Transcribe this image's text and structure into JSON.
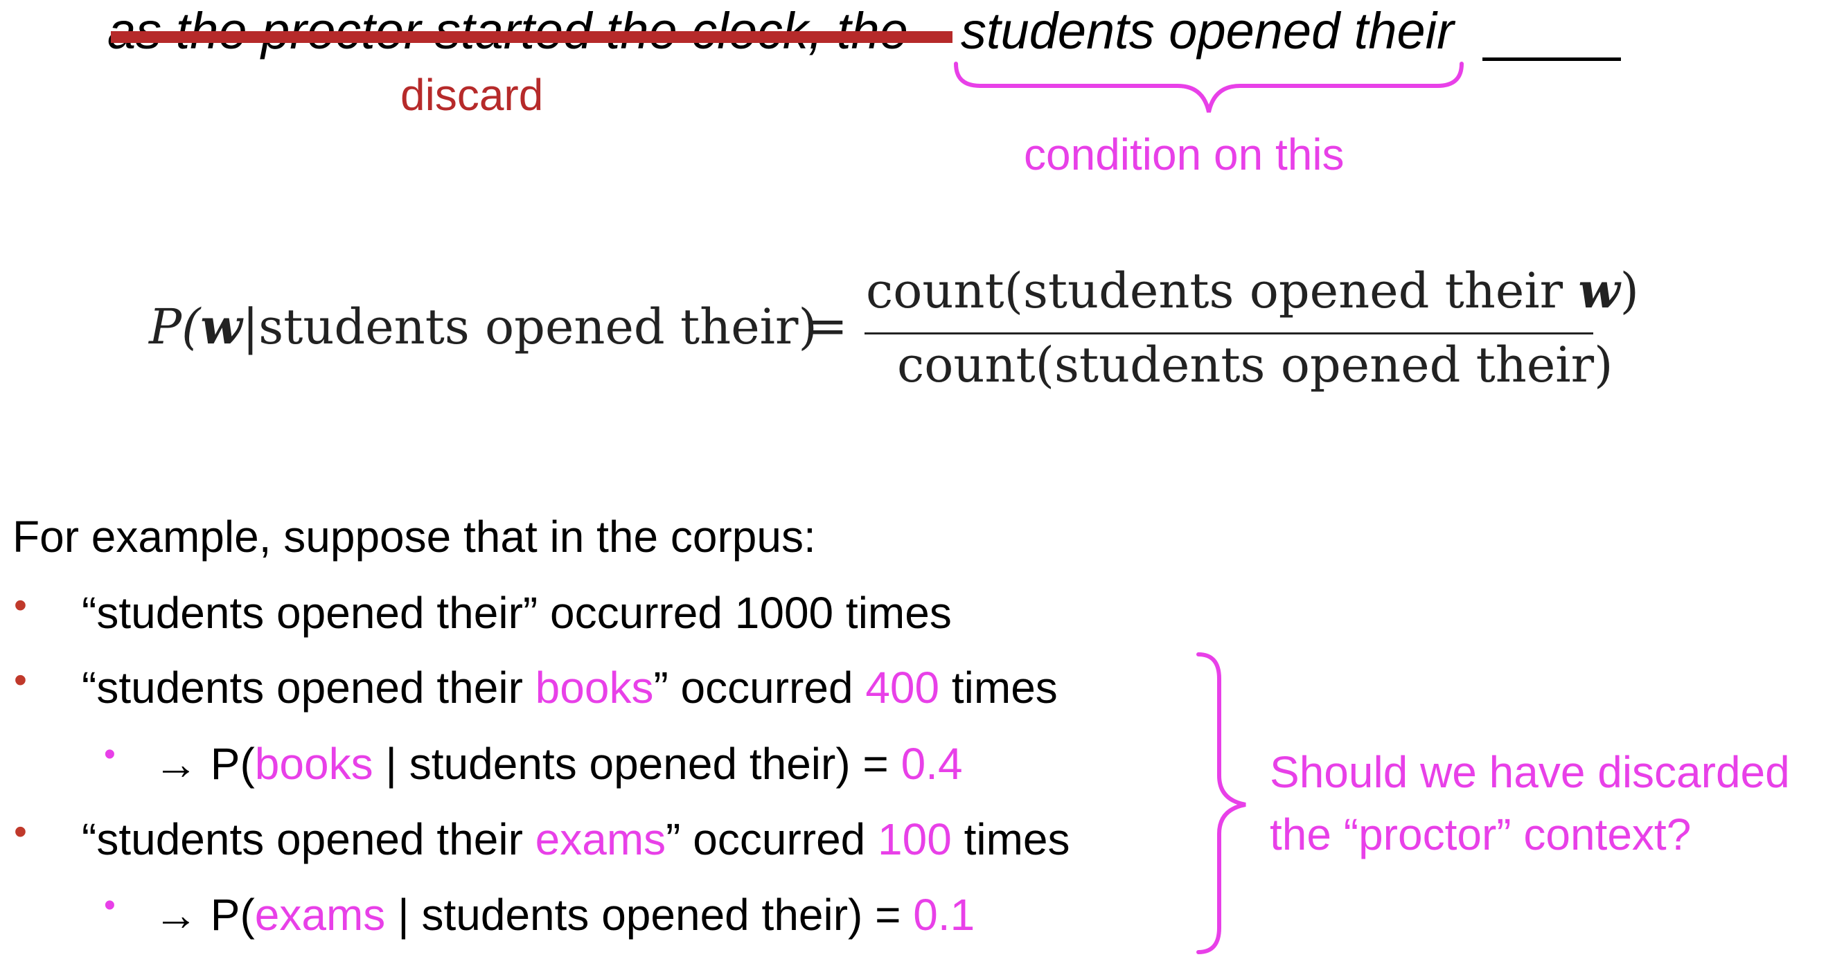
{
  "sentence": {
    "discarded_text": "as the proctor started the clock, the",
    "kept_text": "students opened their",
    "discard_label": "discard",
    "condition_label": "condition on this"
  },
  "formula": {
    "lhs_p": "P(",
    "lhs_w": "w",
    "lhs_rest": "|students opened their)",
    "eq": "=",
    "num_pre": "count(students opened their ",
    "num_w": "w",
    "num_post": ")",
    "den": "count(students opened their)"
  },
  "example": {
    "intro": "For example, suppose that in the corpus:",
    "bullet_glyph": "•",
    "items": [
      {
        "pre": "“students opened their” occurred 1000 times"
      },
      {
        "pre": "“students opened their ",
        "word": "books",
        "mid": "” occurred ",
        "count": "400",
        "post": " times",
        "sub": {
          "arrow": "→ P(",
          "word": "books",
          "rest": " | students opened their) = ",
          "prob": "0.4"
        }
      },
      {
        "pre": "“students opened their ",
        "word": "exams",
        "mid": "” occurred ",
        "count": "100",
        "post": " times",
        "sub": {
          "arrow": "→ P(",
          "word": "exams",
          "rest": " | students opened their) = ",
          "prob": "0.1"
        }
      }
    ]
  },
  "question": {
    "line1": "Should we have discarded",
    "line2": "the “proctor” context?"
  },
  "colors": {
    "red": "#b62a2a",
    "bullet_red": "#c0392b",
    "pink": "#e840e8"
  }
}
